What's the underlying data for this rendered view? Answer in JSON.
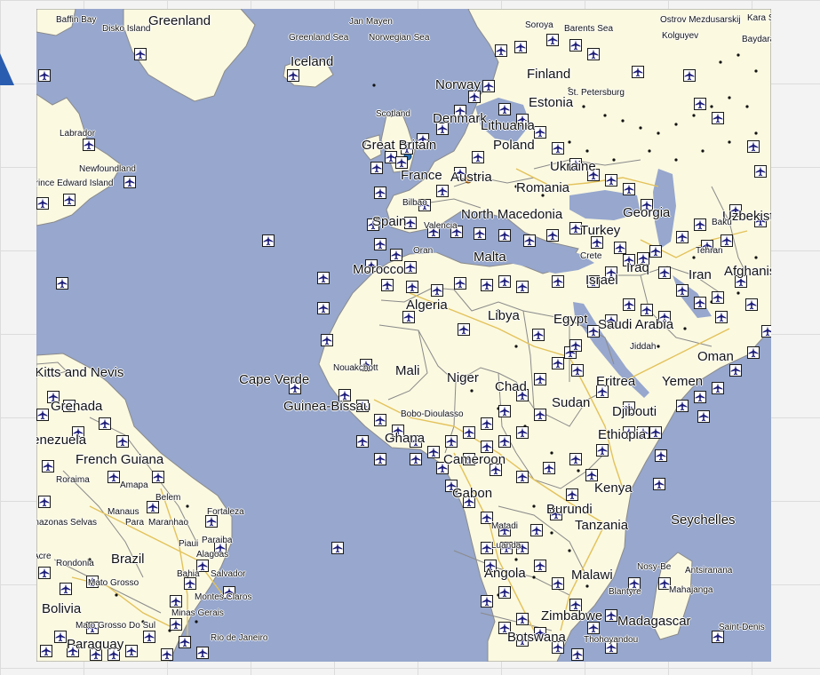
{
  "map": {
    "country_labels": [
      {
        "text": "Greenland",
        "size": "big"
      },
      {
        "text": "Iceland",
        "size": "big"
      },
      {
        "text": "Norway",
        "size": "big"
      },
      {
        "text": "Finland",
        "size": "big"
      },
      {
        "text": "Estonia",
        "size": "big"
      },
      {
        "text": "Denmark",
        "size": "big"
      },
      {
        "text": "Lithuania",
        "size": "big"
      },
      {
        "text": "Great Britain",
        "size": "big"
      },
      {
        "text": "Poland",
        "size": "big"
      },
      {
        "text": "Ukraine",
        "size": "big"
      },
      {
        "text": "France",
        "size": "big"
      },
      {
        "text": "Austria",
        "size": "big"
      },
      {
        "text": "Romania",
        "size": "big"
      },
      {
        "text": "Spain",
        "size": "big"
      },
      {
        "text": "North Macedonia",
        "size": "big"
      },
      {
        "text": "Georgia",
        "size": "big"
      },
      {
        "text": "Uzbekistan",
        "size": "big"
      },
      {
        "text": "Turkey",
        "size": "big"
      },
      {
        "text": "Malta",
        "size": "big"
      },
      {
        "text": "Morocco",
        "size": "big"
      },
      {
        "text": "Iraq",
        "size": "big"
      },
      {
        "text": "Iran",
        "size": "big"
      },
      {
        "text": "Afghanistan",
        "size": "big"
      },
      {
        "text": "Israel",
        "size": "big"
      },
      {
        "text": "Algeria",
        "size": "big"
      },
      {
        "text": "Libya",
        "size": "big"
      },
      {
        "text": "Egypt",
        "size": "big"
      },
      {
        "text": "Saudi Arabia",
        "size": "big"
      },
      {
        "text": "Oman",
        "size": "big"
      },
      {
        "text": "Saint Kitts and Nevis",
        "size": "big"
      },
      {
        "text": "Cape Verde",
        "size": "big"
      },
      {
        "text": "Mali",
        "size": "big"
      },
      {
        "text": "Niger",
        "size": "big"
      },
      {
        "text": "Chad",
        "size": "big"
      },
      {
        "text": "Eritrea",
        "size": "big"
      },
      {
        "text": "Yemen",
        "size": "big"
      },
      {
        "text": "Sudan",
        "size": "big"
      },
      {
        "text": "Grenada",
        "size": "big"
      },
      {
        "text": "Guinea-Bissau",
        "size": "big"
      },
      {
        "text": "Djibouti",
        "size": "big"
      },
      {
        "text": "Venezuela",
        "size": "big"
      },
      {
        "text": "Ghana",
        "size": "big"
      },
      {
        "text": "Ethiopia",
        "size": "big"
      },
      {
        "text": "French Guiana",
        "size": "big"
      },
      {
        "text": "Cameroon",
        "size": "big"
      },
      {
        "text": "Gabon",
        "size": "big"
      },
      {
        "text": "Kenya",
        "size": "big"
      },
      {
        "text": "Burundi",
        "size": "big"
      },
      {
        "text": "Seychelles",
        "size": "big"
      },
      {
        "text": "Tanzania",
        "size": "big"
      },
      {
        "text": "Brazil",
        "size": "big"
      },
      {
        "text": "Angola",
        "size": "big"
      },
      {
        "text": "Malawi",
        "size": "big"
      },
      {
        "text": "Bolivia",
        "size": "big"
      },
      {
        "text": "Zimbabwe",
        "size": "big"
      },
      {
        "text": "Madagascar",
        "size": "big"
      },
      {
        "text": "Botswana",
        "size": "big"
      },
      {
        "text": "Paraguay",
        "size": "big"
      }
    ],
    "small_labels": [
      "Baffin Bay",
      "Disko Island",
      "Jan Mayen",
      "Soroya",
      "Barents Sea",
      "Ostrov Mezdusarskij",
      "Kara Sea",
      "Greenland Sea",
      "Norwegian Sea",
      "Kolguyev",
      "Baydarata Bay",
      "St. Petersburg",
      "Scotland",
      "Labrador",
      "Newfoundland",
      "Prince Edward Island",
      "Bilbao",
      "Valencia",
      "Baku",
      "Tehran",
      "Oran",
      "Crete",
      "Nouakchott",
      "Jiddah",
      "Bobo-Dioulasso",
      "Roraima",
      "Amapa",
      "Belem",
      "Manaus",
      "Fortaleza",
      "Amazonas Selvas",
      "Para",
      "Maranhao",
      "Piaui",
      "Paraiba",
      "Alagoas",
      "Matadi",
      "Luanda",
      "Acre",
      "Rondonia",
      "Bahia",
      "Salvador",
      "Nosy-Be",
      "Antsiranana",
      "Mato Grosso",
      "Blantyre",
      "Mahajanga",
      "Montes Claros",
      "Minas Gerais",
      "Mato Grosso Do Sul",
      "Rio de Janeiro",
      "Thohoyandou",
      "Saint-Denis"
    ],
    "icons": {
      "airport": "airplane-icon",
      "town": "town-dot",
      "edge": "triangle-icon"
    },
    "colors": {
      "ocean": "#97a7cd",
      "land": "#fbf9e0",
      "border": "#8a8a8a",
      "road": "#e3c25a",
      "plane_fill": "#1c1c7a"
    }
  }
}
